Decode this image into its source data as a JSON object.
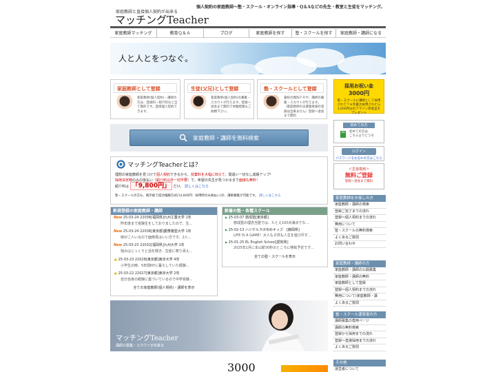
{
  "header": {
    "tagline": "個人契約の家庭教師〜塾・スクール・オンライン指導・Q＆Aなどの先生・教室と生徒をマッチング。",
    "logo_sub": "家庭教師と直接個人契約が出来る",
    "logo_main": "マッチングTeacher"
  },
  "nav": {
    "items": [
      {
        "label": "家庭教師マッチング"
      },
      {
        "label": "教育Ｑ＆Ａ"
      },
      {
        "label": "ブログ"
      },
      {
        "label": "家庭教師を探す"
      },
      {
        "label": "塾・スクールを探す"
      },
      {
        "label": "家庭教師・講師になる"
      }
    ]
  },
  "hero": {
    "text": "人と人とをつなぐ。"
  },
  "register": {
    "teacher": {
      "title": "家庭教師として登録",
      "desc": "家庭教師(個人契約)・講師の方は、登録料・紹介料など全て無料です。直接個人契約できます。",
      "color": "#d9542b"
    },
    "student": {
      "title": "生徒(父兄)として登録",
      "desc": "家庭教師(個人契約)の募集・スカウトが行えます。登録〜退会まで無料で体験授業もご依頼下さい。",
      "color": "#d9542b"
    },
    "school": {
      "title": "塾・スクールとして登録",
      "desc": "貴校の無料ＰＲや、講師の募集・スカウトが行えます。（家庭教師の派遣業者様の登録は出来ません）登録〜退会まで無料",
      "color": "#d9542b"
    }
  },
  "bonus": {
    "line1": "採用お祝い金",
    "line2": "3000円",
    "line3": "塾・スクールに講師として採用されてＴＨ年最大採用されたら3,000円分のアマゾン券進呈をプレゼント"
  },
  "search": {
    "label": "家庭教師・講師を無料検索"
  },
  "side_first": {
    "head": "初めての方",
    "body": "初めての方は\nこちらよりどうぞ"
  },
  "side_login": {
    "button": "ログイン",
    "forgot": "パスワードをお忘れの方はこちら"
  },
  "side_reg": {
    "line1": "＜生徒専用＞",
    "line2": "無料ご登録",
    "line3": "登録〜退会まで無料"
  },
  "about": {
    "title": "マッチングTeacherとは？",
    "p1_a": "理想の家庭教師を見つけて",
    "p1_b": "個人契約",
    "p1_c": "できるから、",
    "p1_d": "授業料を大幅に抑えて",
    "p1_e": "、間違い一切なし成績アップ！",
    "p1_f": "採用決定時",
    "p1_g": "のみの後払い（",
    "p1_h": "紹介料以外一切不要",
    "p1_i": "）で、希望の先生が見つかるまで",
    "p1_j": "面接も無料！",
    "fee_label": "紹介料は",
    "fee_value": "「9,800円」",
    "fee_suffix": "だけ。",
    "fee_link": "詳しくはこちら",
    "p2": "塾・スクールの方も、掲示板で成功報酬方式(14,800円：採用時のみ後払い)の、講師募集が可能です。",
    "p2_link": "詳しくはこちら"
  },
  "teachers": {
    "head": "新規登録の家庭教師・講師",
    "new_badge": "New",
    "rows": [
      {
        "meta": "25-03-24 22038[福岡県]九州工業大学 1年",
        "desc": "昨年度まで受験生をしておりましたので、生..."
      },
      {
        "meta": "25-03-24 22038[東京都]慶應義塾大学 1年",
        "desc": "妹が二人いるので面倒見はいい方です。2人..."
      },
      {
        "meta": "25-03-23 22032[福岡県]九州大学 1年",
        "desc": "強みはじっくりと話を聞き、生徒に寄り添え..."
      },
      {
        "meta": "25-03-23 22028[東京都]東京大学 4年",
        "desc": "小学生の時、5年間NYに暮らしていた経験..."
      },
      {
        "meta": "25-03-22 22027[東京都]東京大学 2年",
        "desc": "自分自身の経験に基づいているので中学受験..."
      }
    ],
    "all": "全ての家庭教師(個人契約)・講師を表示"
  },
  "schools": {
    "head": "新着の塾・各種スクール",
    "rows": [
      {
        "meta": "25-03-07 慈成塾[東京都]",
        "desc": "慈成塾の理念当塾では、たとえ100点満点でな..."
      },
      {
        "meta": "25-02-13 ハジゲルラボゆめキッズ　[静岡県]",
        "desc": "LIFE IS A GAME！大人も子供も人生を遊び尽す..."
      },
      {
        "meta": "25-01-25 EL English School[愛知県]",
        "desc": "2025年1月に本山駅30秒のところに移転予定です..."
      }
    ],
    "all": "全ての塾・スクールを表示"
  },
  "promo": {
    "title": "マッチングTeacher",
    "sub": "講師の募集・スカウトが出来る"
  },
  "bottom": {
    "number": "3000"
  },
  "side_sections": [
    {
      "head": "家庭教師をお探しの方",
      "links": [
        "家庭教師・講師の検索",
        "登録ご完了までの流れ",
        "登録〜個人契約までの流れ",
        "費用について",
        "塾・スクールの無料検索",
        "よくあるご質問",
        "お問い合わせ"
      ]
    },
    {
      "head": "家庭教師・講師の方",
      "links": [
        "家庭教師・講師の公開募集",
        "家庭教師・講師の無料",
        "家庭教師として登録",
        "登録〜個人契約までの流れ",
        "費用について(家庭教師・講",
        "よくあるご質問"
      ]
    },
    {
      "head": "塾・スクール運営者の方",
      "links": [
        "講師募集の専用ページ",
        "講師の無料検索",
        "登録から採用までの流れ",
        "登録〜直接採用までの流れ",
        "よくあるご質問"
      ]
    },
    {
      "head": "その他",
      "links": [
        "運営者について"
      ]
    }
  ]
}
